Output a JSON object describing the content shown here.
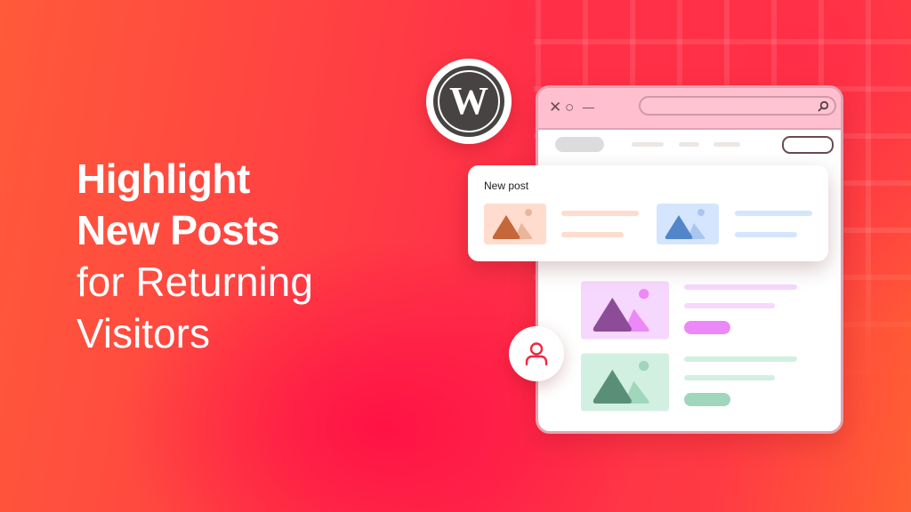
{
  "headline": {
    "line1": "Highlight",
    "line2": "New Posts",
    "line3": "for Returning",
    "line4": "Visitors"
  },
  "icons": {
    "logo": "wordpress-logo-icon",
    "close": "close-icon",
    "restore": "circle-icon",
    "minimize": "minimize-icon",
    "search": "search-icon",
    "user": "user-icon",
    "image": "image-placeholder-icon"
  },
  "window_controls": {
    "close": "✕",
    "restore": "○",
    "minimize": "—"
  },
  "new_post_card": {
    "title": "New post",
    "items": [
      {
        "theme": "orange",
        "bg": "#ffdccd",
        "mountain": "#c4673a",
        "mountain2": "#ebb59b",
        "sun": "#ebb59b",
        "line": "#ffdccd"
      },
      {
        "theme": "blue",
        "bg": "#d5e5fd",
        "mountain": "#5386c9",
        "mountain2": "#a9c6f0",
        "sun": "#a9c6f0",
        "line": "#d5e5fd"
      }
    ]
  },
  "post_list": [
    {
      "theme": "purple",
      "bg": "#f6d7fe",
      "mountain": "#8c4c97",
      "mountain2": "#ec88f8",
      "sun": "#ec88f8",
      "line": "#f6d7fe",
      "pill": "#ec88f8"
    },
    {
      "theme": "green",
      "bg": "#d1f0e2",
      "mountain": "#5a8f77",
      "mountain2": "#9fd6bc",
      "sun": "#9fd6bc",
      "line": "#d1f0e2",
      "pill": "#9fd6bc"
    }
  ],
  "colors": {
    "accent": "#ff2f48",
    "titlebar": "#ffbfcf",
    "user_icon": "#f0283e",
    "wordpress_dark": "#464342"
  }
}
